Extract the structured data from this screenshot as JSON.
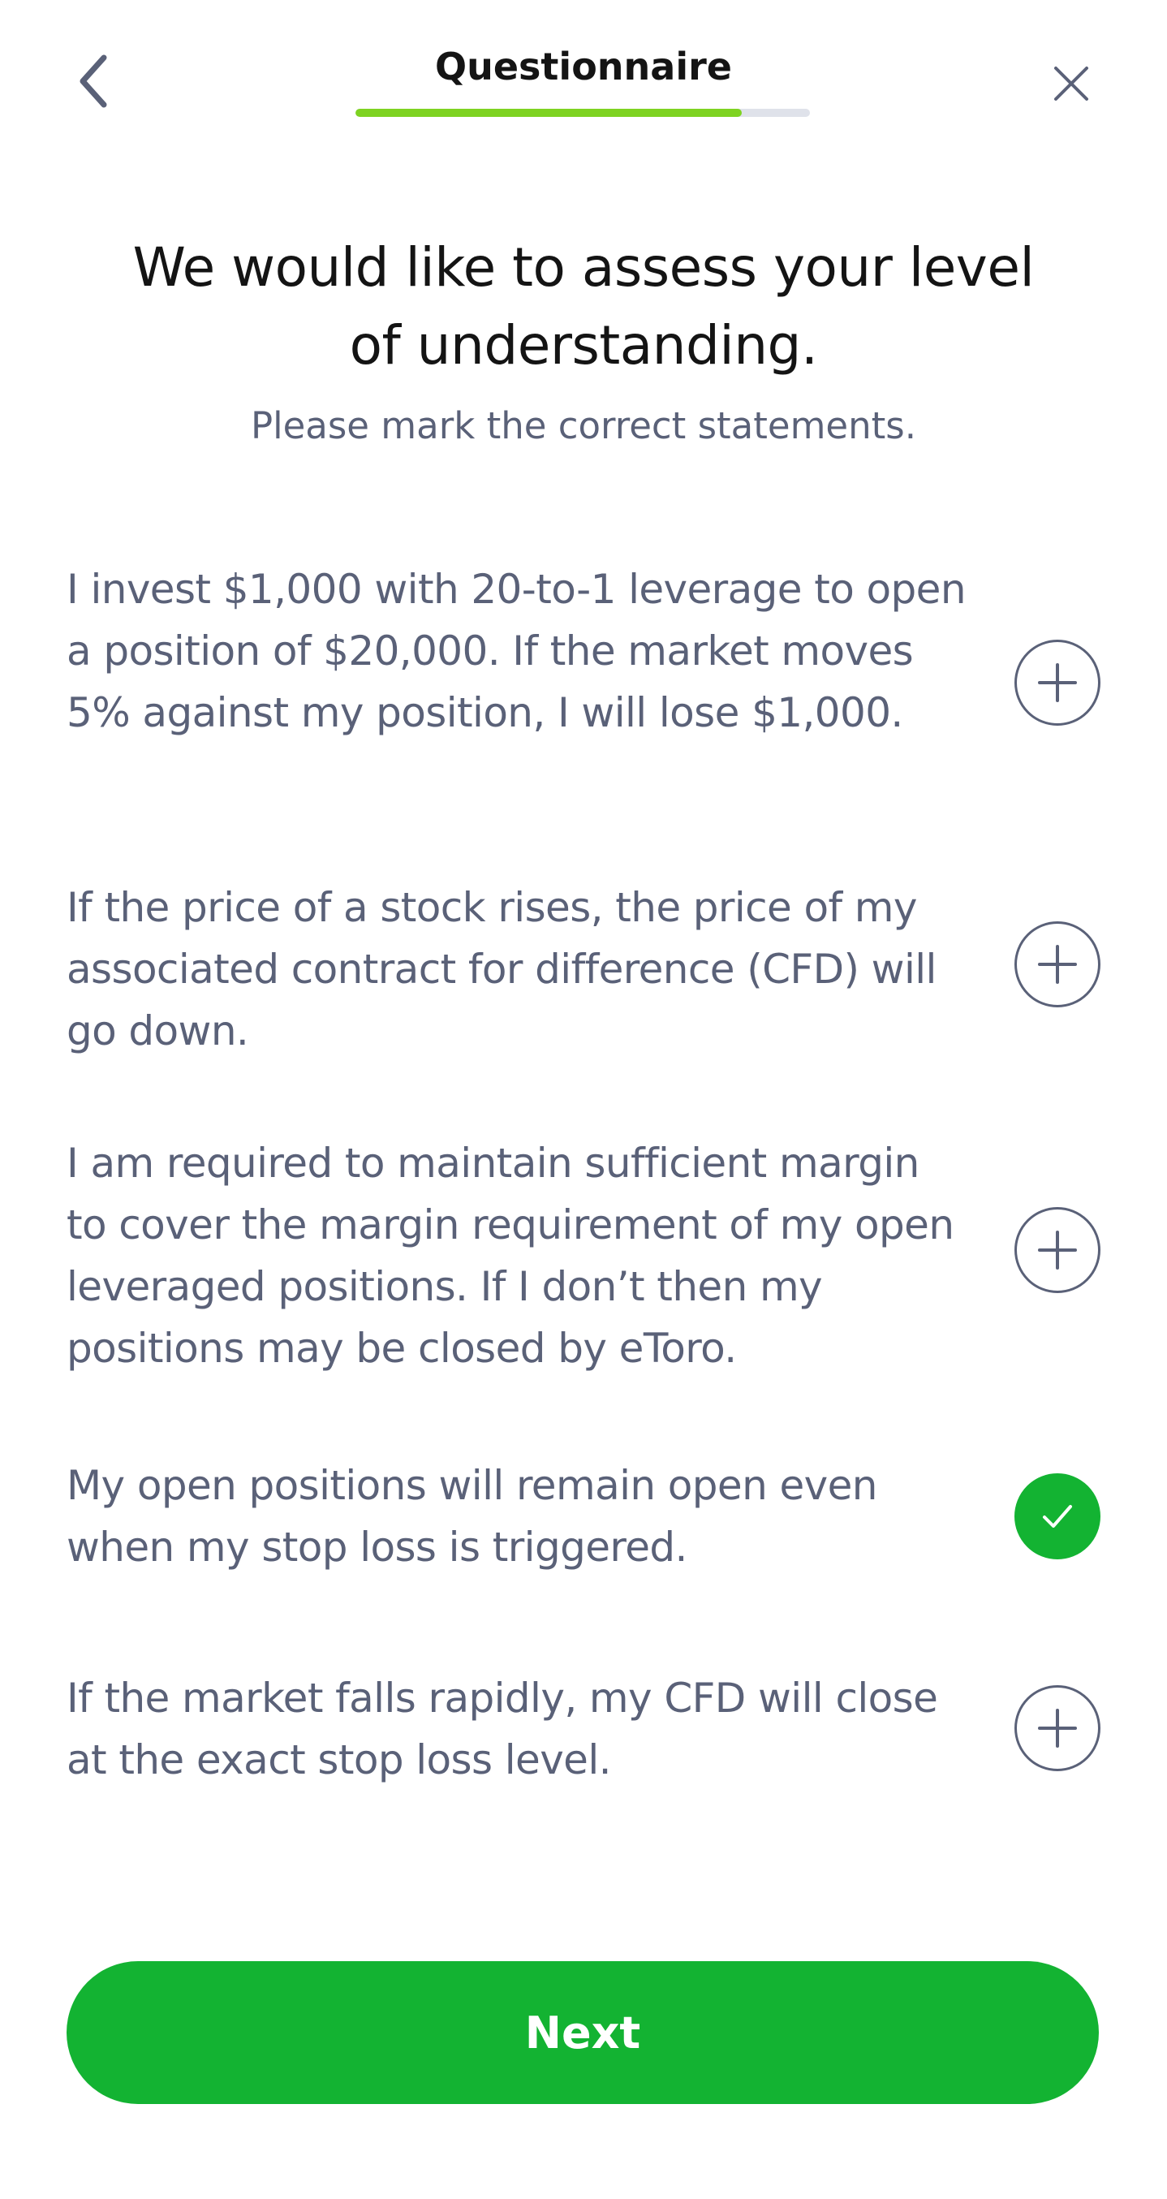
{
  "header": {
    "title": "Questionnaire",
    "back_icon": "chevron-left-icon",
    "close_icon": "close-icon",
    "progress": 0.85
  },
  "intro": {
    "heading": "We would like to assess your level of understanding.",
    "subtitle": "Please mark the correct statements."
  },
  "statements": [
    {
      "text": "I invest $1,000 with 20-to-1 leverage to open a position of $20,000. If the market moves 5% against my position, I will lose $1,000.",
      "checked": false
    },
    {
      "text": "If the price of a stock rises, the price of my associated contract for difference (CFD) will go down.",
      "checked": false
    },
    {
      "text": "I am required to maintain sufficient margin to cover the margin requirement of my open leveraged positions. If I don’t then my positions may be closed by eToro.",
      "checked": false
    },
    {
      "text": "My open positions will remain open even when my stop loss is triggered.",
      "checked": true
    },
    {
      "text": "If the market falls rapidly, my CFD will close at the exact stop loss level.",
      "checked": false
    }
  ],
  "footer": {
    "next_label": "Next"
  },
  "colors": {
    "accent_green": "#13b332",
    "progress_green": "#7ed321",
    "text_gray": "#5a6178",
    "heading": "#141414"
  }
}
